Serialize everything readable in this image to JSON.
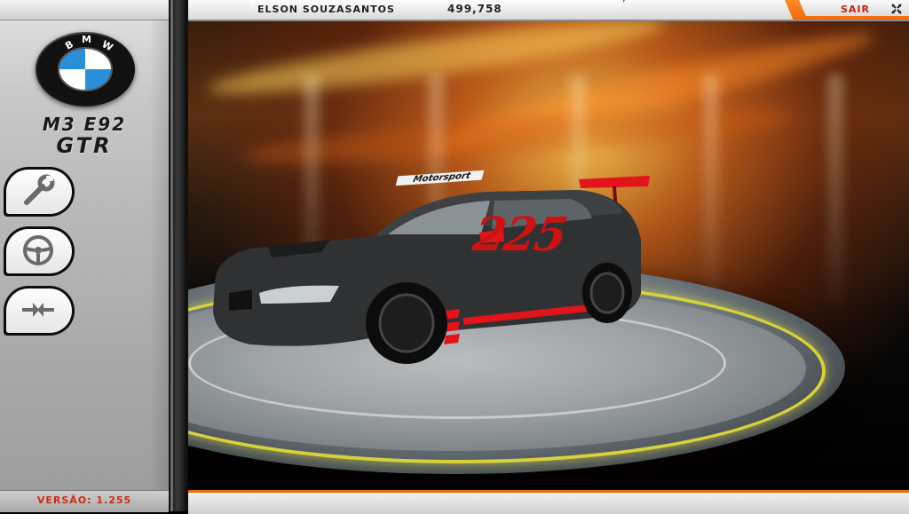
{
  "header": {
    "player_name": "ELSON SOUZASANTOS",
    "money": "499,758",
    "exit_label": "SAIR"
  },
  "car": {
    "brand_logo_letters": "BMW",
    "model_line1": "M3 E92",
    "model_line2": "GTR",
    "race_number": "225",
    "sponsor_text": "Motorsport"
  },
  "side_menu": {
    "items": [
      {
        "icon": "wrench-icon"
      },
      {
        "icon": "steering-wheel-icon"
      },
      {
        "icon": "compare-arrows-icon"
      }
    ]
  },
  "footer": {
    "version": "VERSÃO: 1.255"
  },
  "colors": {
    "accent_orange": "#f26a0a",
    "text_red": "#c32210",
    "ring_yellow": "#d8d23a",
    "livery_red": "#cc1212"
  }
}
